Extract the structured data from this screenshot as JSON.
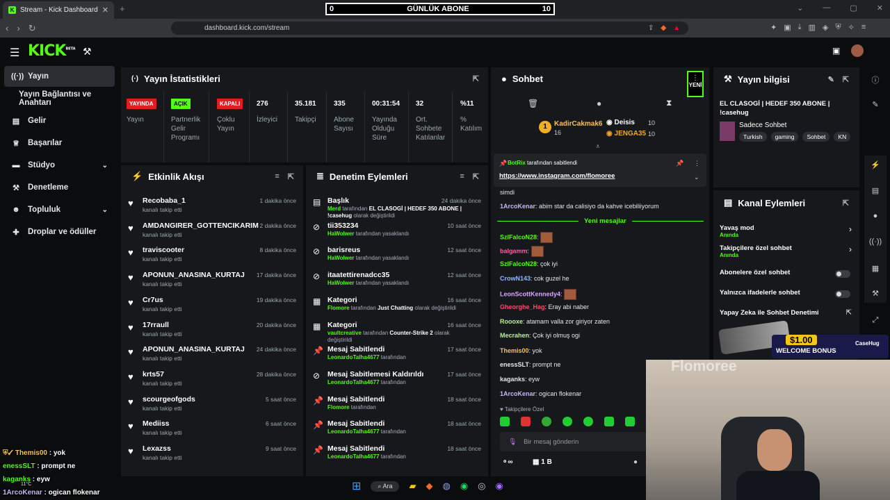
{
  "browser": {
    "tab_title": "Stream - Kick Dashboard",
    "url": "dashboard.kick.com/stream"
  },
  "overlay": {
    "counter_left": "0",
    "counter_title": "GÜNLÜK ABONE",
    "counter_right": "10"
  },
  "header": {
    "logo": "KICK",
    "logo_sup": "BETA"
  },
  "sidebar": {
    "items": [
      {
        "label": "Yayın",
        "icon": "broadcast-icon"
      },
      {
        "label": "Yayın Bağlantısı ve Anahtarı"
      },
      {
        "label": "Gelir",
        "icon": "chart-icon"
      },
      {
        "label": "Başarılar",
        "icon": "trophy-icon"
      },
      {
        "label": "Stüdyo",
        "icon": "studio-icon"
      },
      {
        "label": "Denetleme",
        "icon": "wrench-icon"
      },
      {
        "label": "Topluluk",
        "icon": "community-icon"
      },
      {
        "label": "Droplar ve ödüller",
        "icon": "gift-icon"
      }
    ]
  },
  "stats": {
    "title": "Yayın İstatistikleri",
    "live_badge": "YAYINDA",
    "live_label": "Yayın",
    "partner_badge": "AÇIK",
    "partner_label_1": "Partnerlik",
    "partner_label_2": "Gelir",
    "partner_label_3": "Programı",
    "multi_badge": "KAPALI",
    "multi_label_1": "Çoklu",
    "multi_label_2": "Yayın",
    "viewers": "276",
    "viewers_label": "İzleyici",
    "followers": "35.181",
    "followers_label": "Takipçi",
    "subs": "335",
    "subs_label_1": "Abone",
    "subs_label_2": "Sayısı",
    "duration": "00:31:54",
    "duration_label_1": "Yayında",
    "duration_label_2": "Olduğu",
    "duration_label_3": "Süre",
    "chatters": "32",
    "chatters_label_1": "Ort.",
    "chatters_label_2": "Sohbete",
    "chatters_label_3": "Katılanlar",
    "participation": "%11",
    "participation_label_1": "%",
    "participation_label_2": "Katılım"
  },
  "activity": {
    "title": "Etkinlik Akışı",
    "items": [
      {
        "name": "Recobaba_1",
        "sub": "kanalı takip etti",
        "time": "1 dakika önce"
      },
      {
        "name": "AMDANGIRER_GOTTENCIKARIM",
        "sub": "kanalı takip etti",
        "time": "2 dakika önce"
      },
      {
        "name": "traviscooter",
        "sub": "kanalı takip etti",
        "time": "8 dakika önce"
      },
      {
        "name": "APONUN_ANASINA_KURTAJ",
        "sub": "kanalı takip etti",
        "time": "17 dakika önce"
      },
      {
        "name": "Cr7us",
        "sub": "kanalı takip etti",
        "time": "19 dakika önce"
      },
      {
        "name": "17rraull",
        "sub": "kanalı takip etti",
        "time": "20 dakika önce"
      },
      {
        "name": "APONUN_ANASINA_KURTAJ",
        "sub": "kanalı takip etti",
        "time": "24 dakika önce"
      },
      {
        "name": "krts57",
        "sub": "kanalı takip etti",
        "time": "28 dakika önce"
      },
      {
        "name": "scourgeofgods",
        "sub": "kanalı takip etti",
        "time": "5 saat önce"
      },
      {
        "name": "Mediiss",
        "sub": "kanalı takip etti",
        "time": "6 saat önce"
      },
      {
        "name": "Lexazss",
        "sub": "kanalı takip etti",
        "time": "9 saat önce"
      }
    ]
  },
  "moderation": {
    "title": "Denetim Eylemleri",
    "items": [
      {
        "icon": "title-icon",
        "name": "Başlık",
        "time": "24 dakika önce",
        "actor": "Merd",
        "mid": " tarafından ",
        "obj": "EL CLASOGİ | HEDEF 350 ABONE | !casehug",
        "tail": " olarak değiştirildi"
      },
      {
        "icon": "ban-icon",
        "name": "tii353234",
        "time": "10 saat önce",
        "actor": "HaWolwer",
        "mid": " tarafından yasaklandı",
        "obj": "",
        "tail": ""
      },
      {
        "icon": "ban-icon",
        "name": "barisreus",
        "time": "12 saat önce",
        "actor": "HaWolwer",
        "mid": " tarafından yasaklandı",
        "obj": "",
        "tail": ""
      },
      {
        "icon": "ban-icon",
        "name": "itaatettirenadcc35",
        "time": "12 saat önce",
        "actor": "HaWolwer",
        "mid": " tarafından yasaklandı",
        "obj": "",
        "tail": ""
      },
      {
        "icon": "category-icon",
        "name": "Kategori",
        "time": "16 saat önce",
        "actor": "Flomore",
        "mid": " tarafından ",
        "obj": "Just Chatting",
        "tail": " olarak değiştirildi"
      },
      {
        "icon": "category-icon",
        "name": "Kategori",
        "time": "16 saat önce",
        "actor": "vaultcreative",
        "mid": " tarafından ",
        "obj": "Counter-Strike 2",
        "tail": " olarak değiştirildi"
      },
      {
        "icon": "pin-icon",
        "name": "Mesaj Sabitlendi",
        "time": "17 saat önce",
        "actor": "LeonardoTalha4677",
        "mid": " tarafından",
        "obj": "",
        "tail": ""
      },
      {
        "icon": "unpin-icon",
        "name": "Mesaj Sabitlemesi Kaldırıldı",
        "time": "17 saat önce",
        "actor": "LeonardoTalha4677",
        "mid": " tarafından",
        "obj": "",
        "tail": ""
      },
      {
        "icon": "pin-icon",
        "name": "Mesaj Sabitlendi",
        "time": "18 saat önce",
        "actor": "Flomore",
        "mid": " tarafından",
        "obj": "",
        "tail": ""
      },
      {
        "icon": "pin-icon",
        "name": "Mesaj Sabitlendi",
        "time": "18 saat önce",
        "actor": "LeonardoTalha4677",
        "mid": " tarafından",
        "obj": "",
        "tail": ""
      },
      {
        "icon": "pin-icon",
        "name": "Mesaj Sabitlendi",
        "time": "18 saat önce",
        "actor": "LeonardoTalha4677",
        "mid": " tarafından",
        "obj": "",
        "tail": ""
      }
    ]
  },
  "chat": {
    "title": "Sohbet",
    "new_label": "YENİ",
    "top1_name": "KadirCakmak6",
    "top1_count": "16",
    "top2_name": "Deisis",
    "top2_count": "10",
    "top3_name": "JENGA35",
    "top3_count": "10",
    "pinned_user": "BotRix",
    "pinned_by": "tarafından sabitlendi",
    "pinned_link": "https://www.instagram.com/flomoree",
    "new_messages": "Yeni mesajlar",
    "input_placeholder": "Bir mesaj gönderin",
    "followers_only": "Takipçilere Özel",
    "bottom_count": "1 B",
    "messages": [
      {
        "user": "",
        "text": "simdi",
        "color": "#e6e7e9"
      },
      {
        "user": "1ArcoKenar",
        "text": ": abim star da calisiyo da kahve icebiliiyorum",
        "color": "#c5b6f6"
      },
      {
        "user": "SzlFalcoN28",
        "text": ":",
        "color": "#53fc18"
      },
      {
        "user": "balgamm",
        "text": ":",
        "color": "#ff5ea8"
      },
      {
        "user": "SzlFalcoN28",
        "text": ": çok iyi",
        "color": "#53fc18"
      },
      {
        "user": "CrowN143",
        "text": ": cok guzel he",
        "color": "#8fb8ff"
      },
      {
        "user": "LeonScottKennedy4",
        "text": ":",
        "color": "#d9a7ff"
      },
      {
        "user": "Gheorghe_Hag",
        "text": ": Eray abi naber",
        "color": "#ff4b6e"
      },
      {
        "user": "Roooxe",
        "text": ": atamam valla zor giriyor zaten",
        "color": "#bdf38a"
      },
      {
        "user": "Mecrahen",
        "text": ": Çok iyi olmuş ogi",
        "color": "#bdf38a"
      },
      {
        "user": "Themis00",
        "text": ": yok",
        "color": "#f5c065"
      },
      {
        "user": "enessSLT",
        "text": ": prompt ne",
        "color": "#e6e7e9"
      },
      {
        "user": "kaganks",
        "text": ": eyw",
        "color": "#e6e7e9"
      },
      {
        "user": "1ArcoKenar",
        "text": ": ogican flokenar",
        "color": "#c5b6f6"
      }
    ]
  },
  "stream_info": {
    "title": "Yayın bilgisi",
    "stream_title_1": "EL CLASOGİ | HEDEF 350 ABONE |",
    "stream_title_2": "!casehug",
    "category": "Sadece Sohbet",
    "tags": [
      "Turkish",
      "gaming",
      "Sohbet",
      "KN"
    ]
  },
  "channel_actions": {
    "title": "Kanal Eylemleri",
    "items": [
      {
        "name": "Yavaş mod",
        "sub": "Anında"
      },
      {
        "name": "Takipçilere özel sohbet",
        "sub": "Anında"
      },
      {
        "name": "Abonelere özel sohbet",
        "sub": ""
      },
      {
        "name": "Yalnızca ifadelerle sohbet",
        "sub": ""
      },
      {
        "name": "Yapay Zeka ile Sohbet Denetimi",
        "sub": ""
      }
    ]
  },
  "ad": {
    "amount": "$1.00",
    "label": "WELCOME BONUS",
    "brand": "CaseHug",
    "watermark": "Flomoree"
  },
  "stream_overlay": {
    "lines": [
      {
        "user": "Themis00",
        "text": " : yok"
      },
      {
        "user": "enessSLT",
        "text": " : prompt ne"
      },
      {
        "user": "kaganks",
        "text": " : eyw"
      },
      {
        "user": "1ArcoKenar",
        "text": " : ogican flokenar"
      }
    ],
    "weather": "11°C"
  },
  "taskbar": {
    "search": "Ara"
  },
  "colors": {
    "accent": "#53fc18",
    "live": "#e31b23",
    "panel": "#17181b"
  }
}
